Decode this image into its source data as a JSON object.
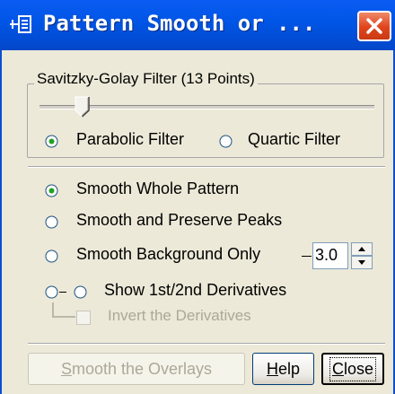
{
  "window": {
    "title": "Pattern Smooth or ...",
    "close_button": "close-icon"
  },
  "filter_group": {
    "label": "Savitzky-Golay Filter (13 Points)",
    "slider_value": 0.13,
    "options": [
      {
        "label": "Parabolic Filter",
        "selected": true
      },
      {
        "label": "Quartic Filter",
        "selected": false
      }
    ]
  },
  "smooth_options": [
    {
      "label": "Smooth Whole Pattern",
      "selected": true
    },
    {
      "label": "Smooth and Preserve Peaks",
      "selected": false
    },
    {
      "label": "Smooth Background Only",
      "selected": false
    },
    {
      "label": "Show 1st/2nd Derivatives",
      "selected": false
    }
  ],
  "background_value": "3.0",
  "invert_derivatives": {
    "label": "Invert the Derivatives",
    "checked": false,
    "enabled": false
  },
  "buttons": {
    "smooth_overlays": {
      "mnemonic": "S",
      "rest": "mooth the Overlays",
      "enabled": false
    },
    "help": {
      "mnemonic": "H",
      "rest": "elp"
    },
    "close": {
      "mnemonic": "C",
      "rest": "lose"
    }
  }
}
